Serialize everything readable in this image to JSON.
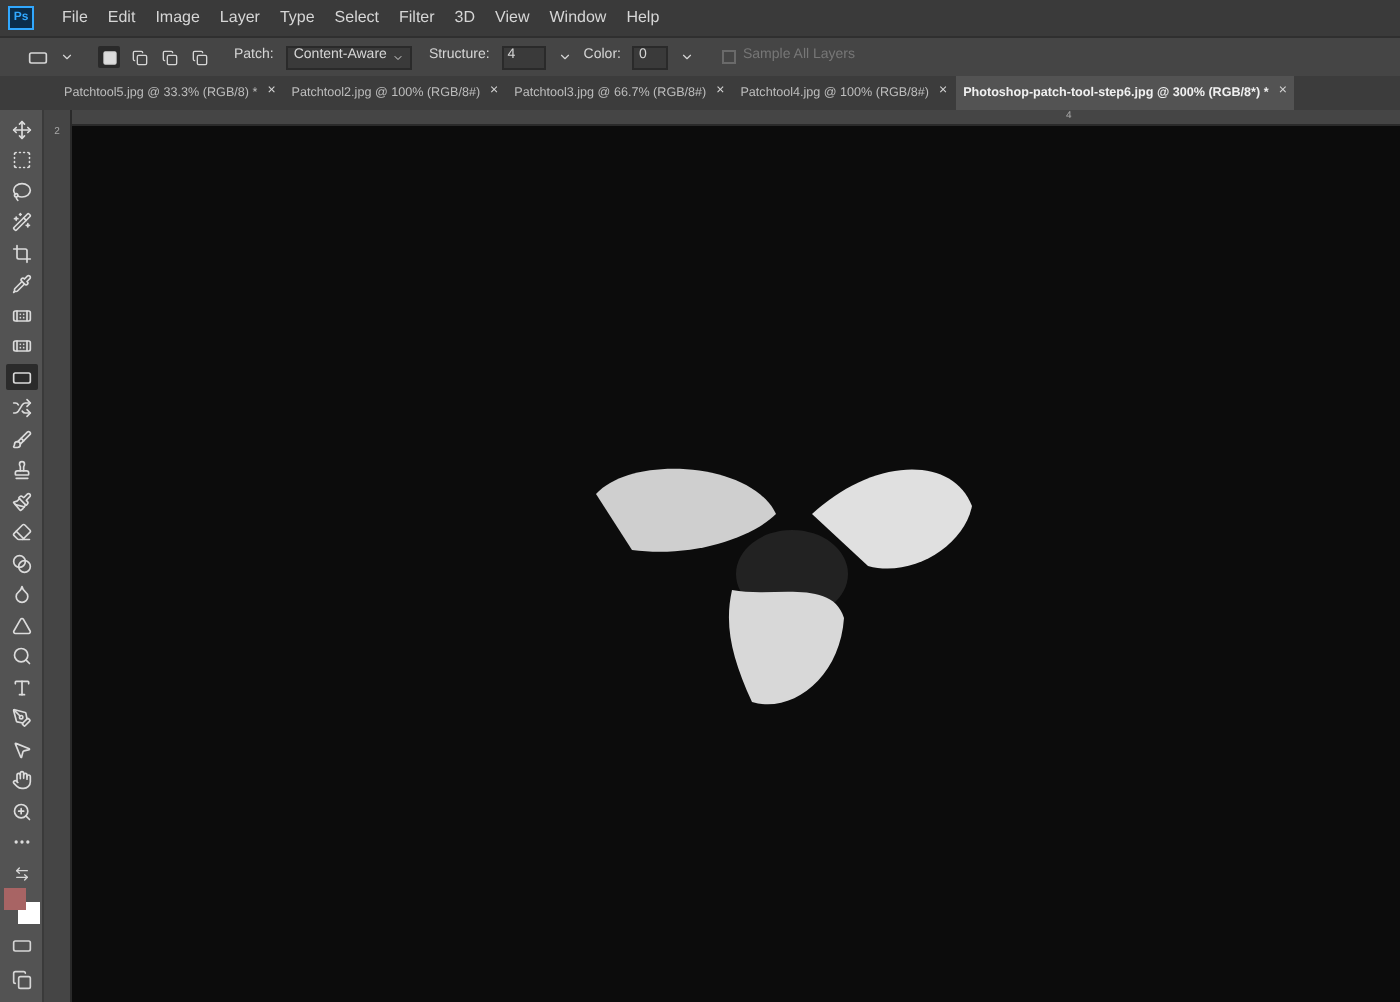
{
  "app": {
    "logo": "Ps"
  },
  "menu": [
    "File",
    "Edit",
    "Image",
    "Layer",
    "Type",
    "Select",
    "Filter",
    "3D",
    "View",
    "Window",
    "Help"
  ],
  "options": {
    "modes": [
      {
        "selected": true
      },
      {
        "selected": false
      },
      {
        "selected": false
      },
      {
        "selected": false
      }
    ],
    "patch_label": "Patch:",
    "patch_value": "Content-Aware",
    "structure_label": "Structure:",
    "structure_value": "4",
    "color_label": "Color:",
    "color_value": "0",
    "sample_all_layers": {
      "label": "Sample All Layers",
      "checked": false,
      "disabled": true
    }
  },
  "tabs": [
    {
      "label": "Patchtool5.jpg @ 33.3% (RGB/8) *",
      "close": "×",
      "selected": false
    },
    {
      "label": "Patchtool2.jpg @ 100% (RGB/8#)",
      "close": "×",
      "selected": false
    },
    {
      "label": "Patchtool3.jpg @ 66.7% (RGB/8#)",
      "close": "×",
      "selected": false
    },
    {
      "label": "Patchtool4.jpg @ 100% (RGB/8#)",
      "close": "×",
      "selected": false
    },
    {
      "label": "Photoshop-patch-tool-step6.jpg @ 300% (RGB/8*) *",
      "close": "×",
      "selected": true
    }
  ],
  "tools": [
    {
      "selected": false
    },
    {
      "selected": false
    },
    {
      "selected": false
    },
    {
      "selected": false
    },
    {
      "selected": false
    },
    {
      "selected": false
    },
    {
      "selected": false
    },
    {
      "selected": false
    },
    {
      "selected": true
    },
    {
      "selected": false
    },
    {
      "selected": false
    },
    {
      "selected": false
    },
    {
      "selected": false
    },
    {
      "selected": false
    },
    {
      "selected": false
    },
    {
      "selected": false
    },
    {
      "selected": false
    },
    {
      "selected": false
    },
    {
      "selected": false
    },
    {
      "selected": false
    },
    {
      "selected": false
    },
    {
      "selected": false
    },
    {
      "selected": false
    },
    {
      "selected": false
    }
  ],
  "swatches": [
    {
      "kind": "foreground",
      "color": "#a86464"
    },
    {
      "kind": "background",
      "color": "#ffffff"
    }
  ],
  "rulers": {
    "top_label": "4",
    "left_label": "2"
  }
}
